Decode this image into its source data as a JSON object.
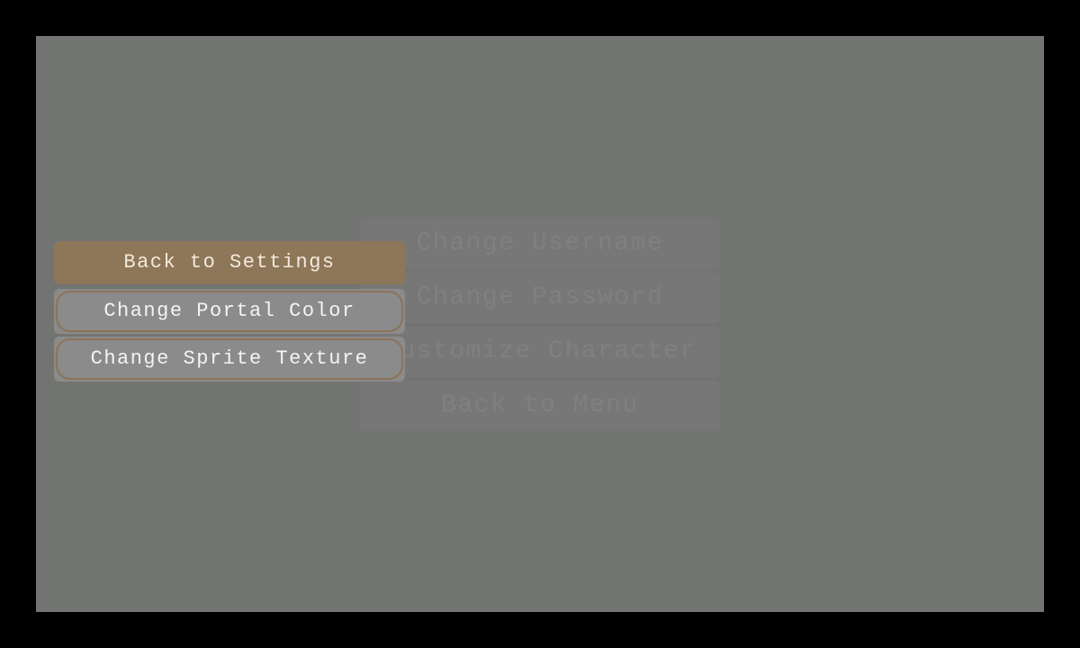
{
  "background_menu": {
    "items": [
      {
        "label": "Change Username"
      },
      {
        "label": "Change Password"
      },
      {
        "label": "Customize Character"
      },
      {
        "label": "Back to Menu"
      }
    ]
  },
  "submenu": {
    "back_label": "Back to Settings",
    "options": [
      {
        "label": "Change Portal Color"
      },
      {
        "label": "Change Sprite Texture"
      }
    ]
  },
  "colors": {
    "backdrop": "#727472",
    "accent": "#8e7659",
    "accent_text": "#f3ead9",
    "option_fill": "#8a8b8a",
    "option_border": "#8c7358"
  }
}
